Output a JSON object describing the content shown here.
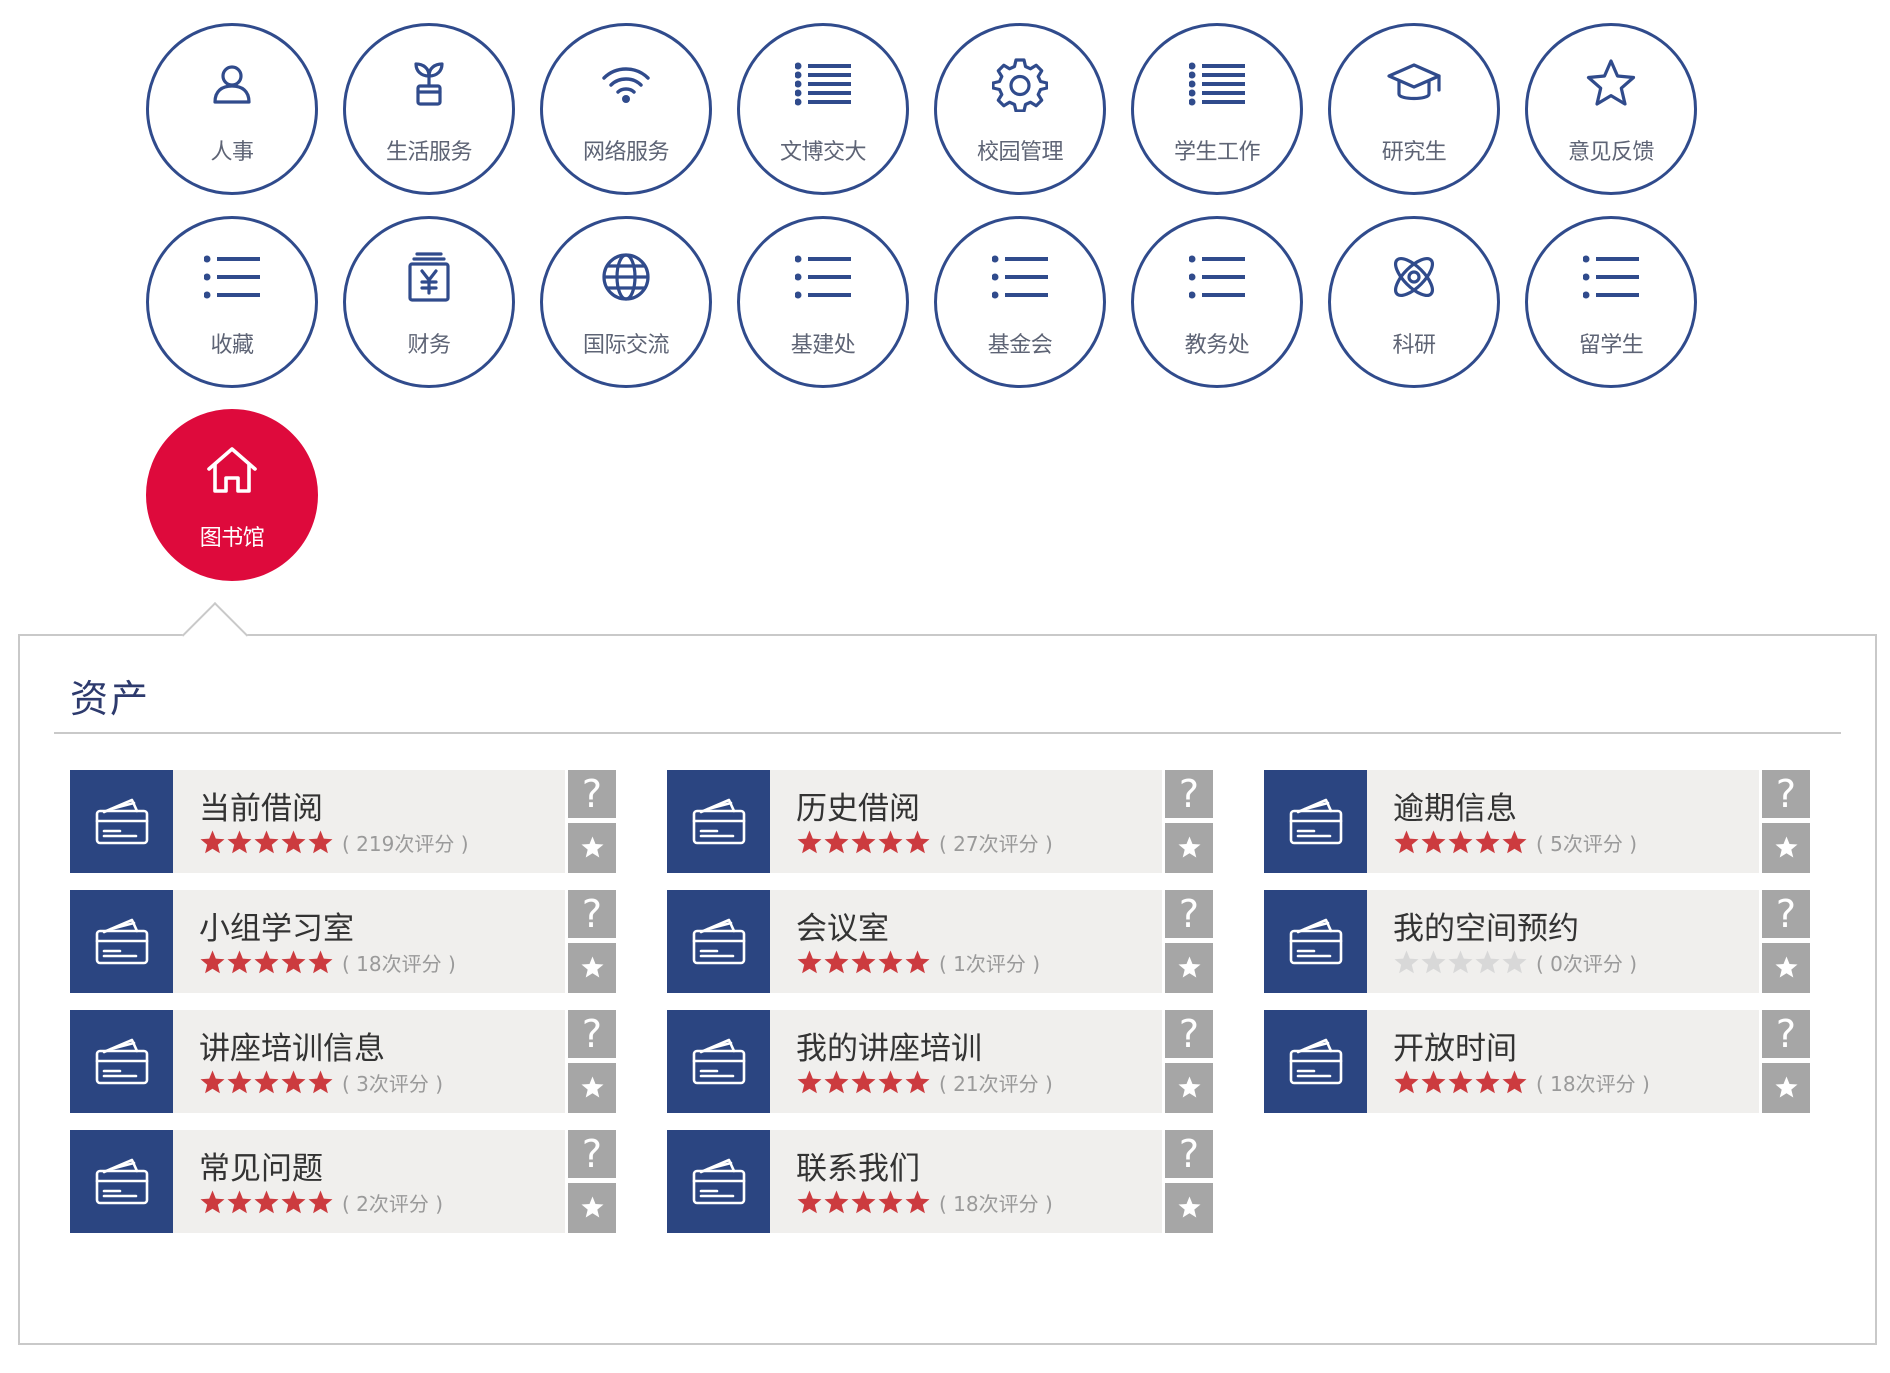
{
  "colors": {
    "circle_border": "#304b8c",
    "circle_text": "#5e6475",
    "active": "#de0a3c",
    "card_icon_bg": "#2b4581",
    "card_body_bg": "#f0efed",
    "card_side_bg": "#a6a6a6",
    "star_filled": "#cc3b3f",
    "star_empty": "#d8d8d8",
    "panel_title": "#2d3a6d"
  },
  "categories": [
    {
      "label": "人事",
      "icon": "user-icon"
    },
    {
      "label": "生活服务",
      "icon": "sprout-icon"
    },
    {
      "label": "网络服务",
      "icon": "wifi-icon"
    },
    {
      "label": "文博交大",
      "icon": "list-icon"
    },
    {
      "label": "校园管理",
      "icon": "gear-icon"
    },
    {
      "label": "学生工作",
      "icon": "list-icon"
    },
    {
      "label": "研究生",
      "icon": "graduation-cap-icon"
    },
    {
      "label": "意见反馈",
      "icon": "star-outline-icon"
    },
    {
      "label": "收藏",
      "icon": "list-icon"
    },
    {
      "label": "财务",
      "icon": "yen-icon"
    },
    {
      "label": "国际交流",
      "icon": "globe-icon"
    },
    {
      "label": "基建处",
      "icon": "list-icon"
    },
    {
      "label": "基金会",
      "icon": "list-icon"
    },
    {
      "label": "教务处",
      "icon": "list-icon"
    },
    {
      "label": "科研",
      "icon": "atom-icon"
    },
    {
      "label": "留学生",
      "icon": "list-icon"
    },
    {
      "label": "图书馆",
      "icon": "home-icon",
      "active": true
    }
  ],
  "panel": {
    "title": "资产",
    "help_symbol": "?",
    "cards": [
      {
        "title": "当前借阅",
        "rating_text": "( 219次评分 )",
        "stars": 5
      },
      {
        "title": "历史借阅",
        "rating_text": "( 27次评分 )",
        "stars": 5
      },
      {
        "title": "逾期信息",
        "rating_text": "( 5次评分 )",
        "stars": 5
      },
      {
        "title": "小组学习室",
        "rating_text": "( 18次评分 )",
        "stars": 5
      },
      {
        "title": "会议室",
        "rating_text": "( 1次评分 )",
        "stars": 5
      },
      {
        "title": "我的空间预约",
        "rating_text": "( 0次评分 )",
        "stars": 0
      },
      {
        "title": "讲座培训信息",
        "rating_text": "( 3次评分 )",
        "stars": 5
      },
      {
        "title": "我的讲座培训",
        "rating_text": "( 21次评分 )",
        "stars": 5
      },
      {
        "title": "开放时间",
        "rating_text": "( 18次评分 )",
        "stars": 5
      },
      {
        "title": "常见问题",
        "rating_text": "( 2次评分 )",
        "stars": 5
      },
      {
        "title": "联系我们",
        "rating_text": "( 18次评分 )",
        "stars": 5
      }
    ]
  }
}
